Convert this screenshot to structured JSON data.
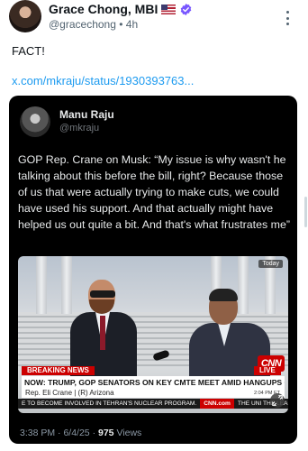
{
  "post": {
    "author_name": "Grace Chong, MBI",
    "author_flag_icon": "us-flag-icon",
    "verified_icon": "verified-badge-icon",
    "verified_color": "#7856ff",
    "handle": "@gracechong",
    "separator": "•",
    "age": "4h",
    "text": "FACT!",
    "link": "x.com/mkraju/status/1930393763..."
  },
  "quote": {
    "author_name": "Manu Raju",
    "handle": "@mkraju",
    "text": "GOP Rep. Crane on Musk: “My issue is why wasn't he talking about this before the bill, right? Because those of us that were actually trying to make cuts, we could have used his support. And that actually might have helped us out quite a bit. And that's what frustrates me”",
    "video": {
      "corner_tag": "Today",
      "breaking_label": "BREAKING NEWS",
      "live_label": "LIVE",
      "network_logo": "CNN",
      "headline": "NOW: TRUMP, GOP SENATORS ON KEY CMTE MEET AMID HANGUPS ON BILL",
      "lower_third": "Rep. Eli Crane  |  (R) Arizona",
      "clock": "2:04 PM ET",
      "ticker_left": "E TO BECOME INVOLVED IN TEHRAN'S NUCLEAR PROGRAM.",
      "ticker_site": "CNN.com",
      "ticker_right": "THE UNI  THE LEA",
      "expand_icon": "expand-icon"
    },
    "time": "3:38 PM",
    "dot": "·",
    "date": "6/4/25",
    "views_count": "975",
    "views_label": "Views"
  },
  "colors": {
    "accent_link": "#1d9bf0",
    "cnn_red": "#cc0000"
  }
}
